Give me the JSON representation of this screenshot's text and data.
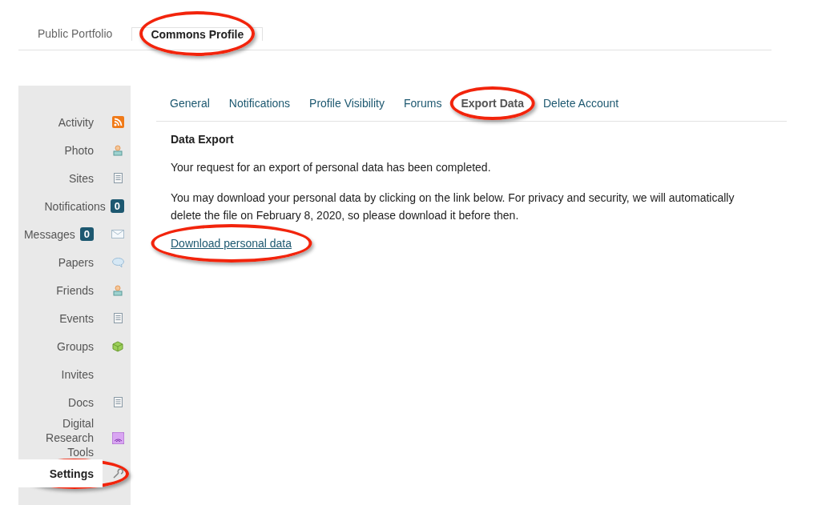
{
  "top_tabs": [
    {
      "label": "Public Portfolio",
      "selected": false,
      "circled": false
    },
    {
      "label": "Commons Profile",
      "selected": true,
      "circled": true
    }
  ],
  "sidebar": {
    "items": [
      {
        "label": "Activity",
        "kind": "rss",
        "selected": false,
        "circled": false
      },
      {
        "label": "Photo",
        "kind": "person",
        "selected": false,
        "circled": false
      },
      {
        "label": "Sites",
        "kind": "doc",
        "selected": false,
        "circled": false
      },
      {
        "label": "Notifications",
        "badge": "0",
        "selected": false,
        "circled": false
      },
      {
        "label": "Messages",
        "badge": "0",
        "kind": "mail",
        "selected": false,
        "circled": false
      },
      {
        "label": "Papers",
        "kind": "bubble",
        "selected": false,
        "circled": false
      },
      {
        "label": "Friends",
        "kind": "person",
        "selected": false,
        "circled": false
      },
      {
        "label": "Events",
        "kind": "doc",
        "selected": false,
        "circled": false
      },
      {
        "label": "Groups",
        "kind": "cube",
        "selected": false,
        "circled": false
      },
      {
        "label": "Invites",
        "selected": false,
        "circled": false
      },
      {
        "label": "Docs",
        "kind": "doc",
        "selected": false,
        "circled": false
      },
      {
        "label": "Digital Research Tools",
        "kind": "signal",
        "selected": false,
        "circled": false
      },
      {
        "label": "Settings",
        "kind": "wrench",
        "selected": true,
        "circled": true
      }
    ]
  },
  "subnav": [
    {
      "label": "General",
      "selected": false,
      "circled": false
    },
    {
      "label": "Notifications",
      "selected": false,
      "circled": false
    },
    {
      "label": "Profile Visibility",
      "selected": false,
      "circled": false
    },
    {
      "label": "Forums",
      "selected": false,
      "circled": false
    },
    {
      "label": "Export Data",
      "selected": true,
      "circled": true
    },
    {
      "label": "Delete Account",
      "selected": false,
      "circled": false
    }
  ],
  "content": {
    "heading": "Data Export",
    "paragraphs": [
      "Your request for an export of personal data has been completed.",
      "You may download your personal data by clicking on the link below. For privacy and security, we will automatically delete the file on February 8, 2020, so please download it before then."
    ],
    "link": {
      "label": "Download personal data",
      "circled": true
    }
  }
}
